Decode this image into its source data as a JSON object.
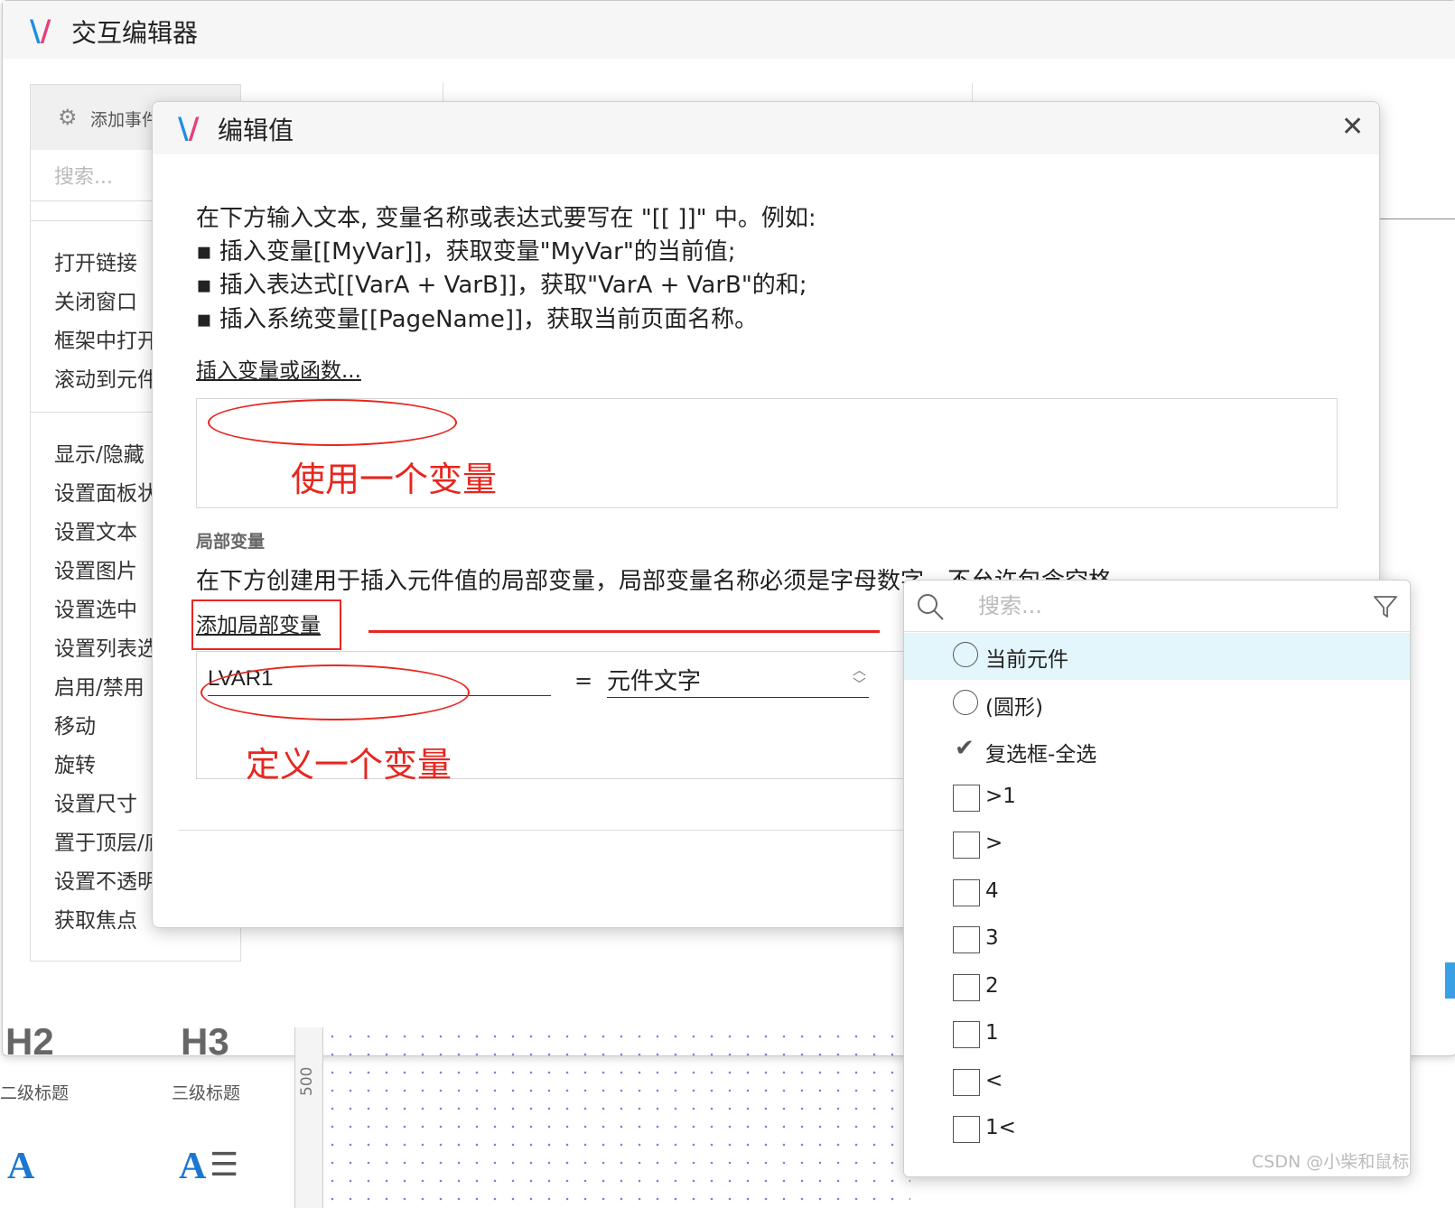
{
  "outer_window": {
    "title": "交互编辑器",
    "add_event": "添加事件",
    "search_placeholder": "搜索...",
    "actions_group1": [
      "打开链接",
      "关闭窗口",
      "框架中打开",
      "滚动到元件"
    ],
    "actions_group2": [
      "显示/隐藏",
      "设置面板状",
      "设置文本",
      "设置图片",
      "设置选中",
      "设置列表选",
      "启用/禁用",
      "移动",
      "旋转",
      "设置尺寸",
      "置于顶层/底",
      "设置不透明",
      "获取焦点"
    ]
  },
  "library": {
    "h2": "H2",
    "h2_label": "二级标题",
    "h3": "H3",
    "h3_label": "三级标题",
    "a1": "A",
    "a2": "A",
    "a2_lines": "☰",
    "ruler_value": "500"
  },
  "dialog": {
    "title": "编辑值",
    "close_icon": "close-icon",
    "instructions": [
      "在下方输入文本, 变量名称或表达式要写在 \"[[ ]]\" 中。例如:",
      "▪ 插入变量[[MyVar]]，获取变量\"MyVar\"的当前值;",
      "▪ 插入表达式[[VarA + VarB]]，获取\"VarA + VarB\"的和;",
      "▪ 插入系统变量[[PageName]]，获取当前页面名称。"
    ],
    "insert_link": "插入变量或函数...",
    "local_section_title": "局部变量",
    "local_desc": "在下方创建用于插入元件值的局部变量，局部变量名称必须是字母数字，不允许包含空格。",
    "add_local_link": "添加局部变量",
    "local_var": {
      "name": "LVAR1",
      "equals": "=",
      "target": "元件文字"
    }
  },
  "annotations": {
    "use_variable": "使用一个变量",
    "define_variable": "定义一个变量",
    "color": "#e8261f"
  },
  "popup": {
    "search_placeholder": "搜索...",
    "search_icon": "search-icon",
    "filter_icon": "filter-icon",
    "options": [
      {
        "label": "当前元件",
        "kind": "radio",
        "selected": true
      },
      {
        "label": "(圆形)",
        "kind": "radio",
        "selected": false
      },
      {
        "label": "复选框-全选",
        "kind": "tick",
        "selected": false
      },
      {
        "label": ">1",
        "kind": "checkbox",
        "selected": false
      },
      {
        "label": ">",
        "kind": "checkbox",
        "selected": false
      },
      {
        "label": "4",
        "kind": "checkbox",
        "selected": false
      },
      {
        "label": "3",
        "kind": "checkbox",
        "selected": false
      },
      {
        "label": "2",
        "kind": "checkbox",
        "selected": false
      },
      {
        "label": "1",
        "kind": "checkbox",
        "selected": false
      },
      {
        "label": "<",
        "kind": "checkbox",
        "selected": false
      },
      {
        "label": "1<",
        "kind": "checkbox",
        "selected": false
      }
    ],
    "selected_color": "#e3f6fb"
  },
  "watermark": "CSDN @小柴和鼠标"
}
